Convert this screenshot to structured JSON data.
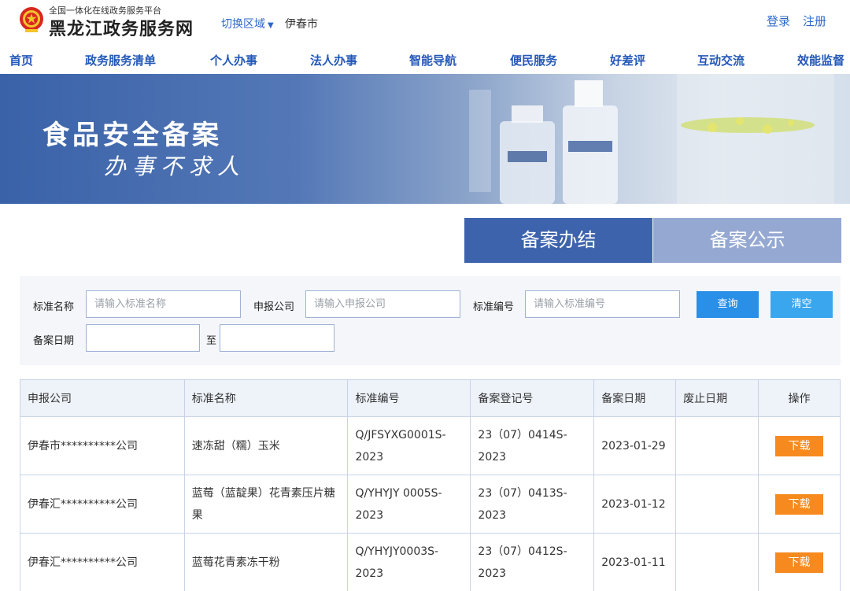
{
  "header": {
    "platform": "全国一体化在线政务服务平台",
    "site_name": "黑龙江政务服务网",
    "region_switch": "切换区域",
    "city": "伊春市",
    "login": "登录",
    "register": "注册"
  },
  "nav": [
    "首页",
    "政务服务清单",
    "个人办事",
    "法人办事",
    "智能导航",
    "便民服务",
    "好差评",
    "互动交流",
    "效能监督"
  ],
  "banner": {
    "title": "食品安全备案",
    "slogan": "办事不求人"
  },
  "tabs": {
    "done": "备案办结",
    "public": "备案公示"
  },
  "search": {
    "std_name_label": "标准名称",
    "std_name_placeholder": "请输入标准名称",
    "company_label": "申报公司",
    "company_placeholder": "请输入申报公司",
    "std_no_label": "标准编号",
    "std_no_placeholder": "请输入标准编号",
    "date_label": "备案日期",
    "to_label": "至",
    "query_btn": "查询",
    "clear_btn": "清空"
  },
  "table": {
    "headers": [
      "申报公司",
      "标准名称",
      "标准编号",
      "备案登记号",
      "备案日期",
      "废止日期",
      "操作"
    ],
    "rows": [
      {
        "company": "伊春市**********公司",
        "std_name": "速冻甜（糯）玉米",
        "std_no": "Q/JFSYXG0001S-2023",
        "reg_no": "23（07）0414S-2023",
        "date": "2023-01-29",
        "abolish": "",
        "action": "下载"
      },
      {
        "company": "伊春汇**********公司",
        "std_name": "蓝莓（蓝靛果）花青素压片糖果",
        "std_no": "Q/YHYJY 0005S-2023",
        "reg_no": "23（07）0413S-2023",
        "date": "2023-01-12",
        "abolish": "",
        "action": "下载"
      },
      {
        "company": "伊春汇**********公司",
        "std_name": "蓝莓花青素冻干粉",
        "std_no": "Q/YHYJY0003S-2023",
        "reg_no": "23（07）0412S-2023",
        "date": "2023-01-11",
        "abolish": "",
        "action": "下载"
      }
    ]
  },
  "colors": {
    "brand_blue": "#2358b8",
    "tab_active": "#3d63ad",
    "tab_inactive": "#94a8d2",
    "button_blue": "#2a8fe6",
    "download_orange": "#f68a1f"
  },
  "icons": {
    "emblem": "national-emblem-icon",
    "region_caret": "caret-down-icon"
  }
}
